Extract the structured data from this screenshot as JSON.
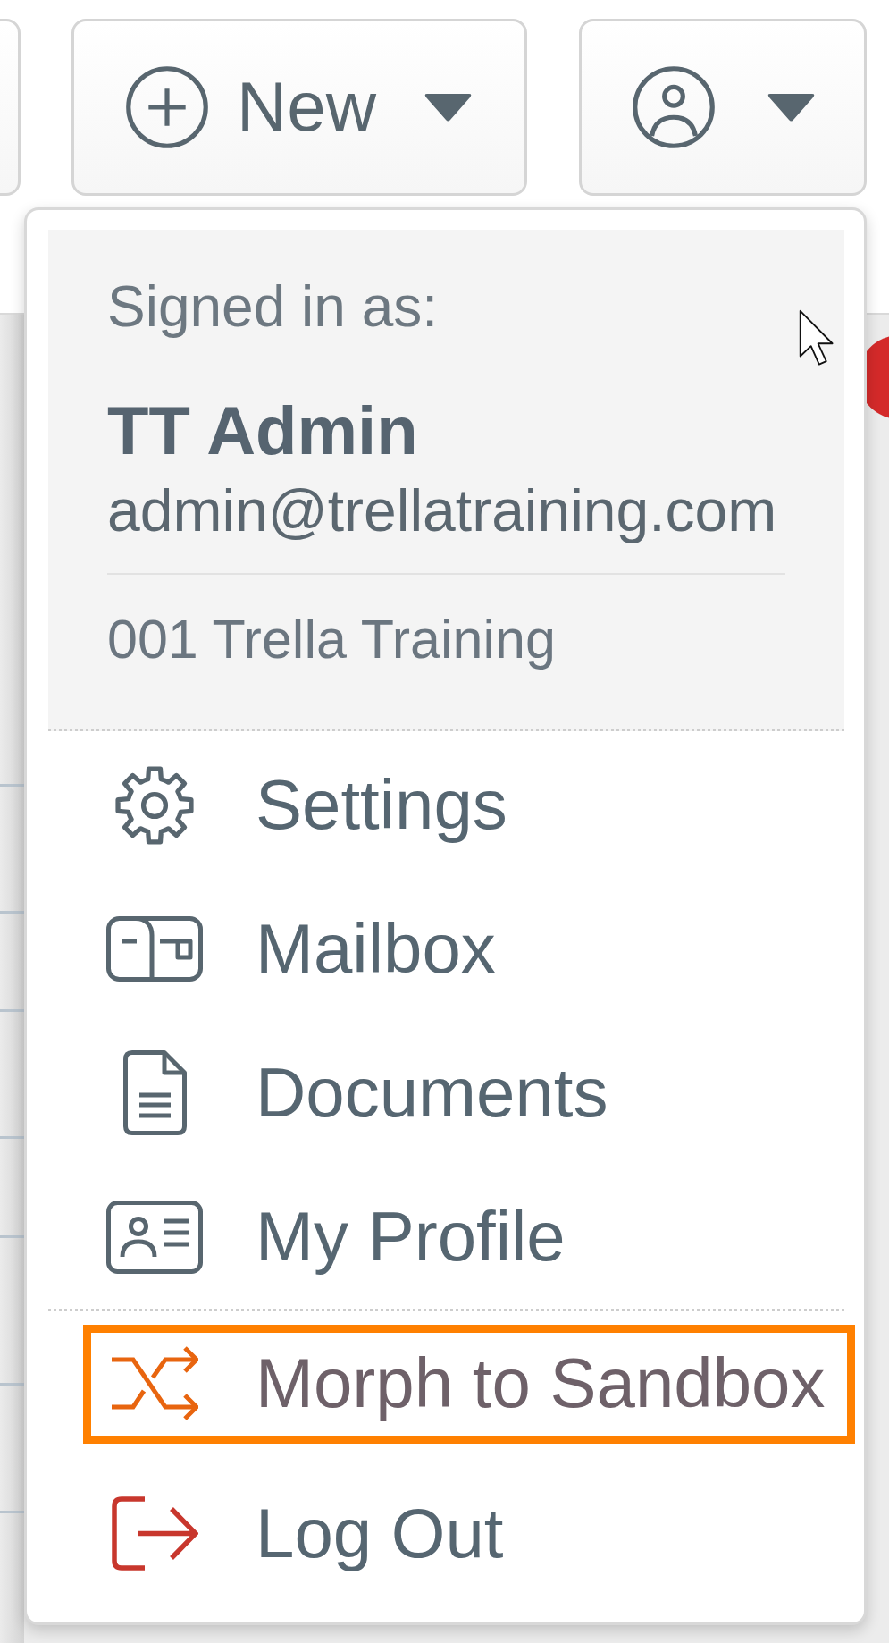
{
  "toolbar": {
    "new_button": {
      "label": "New"
    }
  },
  "account_menu": {
    "signed_in_label": "Signed in as:",
    "user_name": "TT Admin",
    "email": "admin@trellatraining.com",
    "organization": "001 Trella Training",
    "sections": [
      {
        "items": [
          {
            "label": "Settings",
            "highlighted": false
          },
          {
            "label": "Mailbox",
            "highlighted": false
          },
          {
            "label": "Documents",
            "highlighted": false
          },
          {
            "label": "My Profile",
            "highlighted": false
          }
        ]
      },
      {
        "items": [
          {
            "label": "Morph to Sandbox",
            "highlighted": true
          },
          {
            "label": "Log Out",
            "highlighted": false
          }
        ]
      }
    ]
  }
}
